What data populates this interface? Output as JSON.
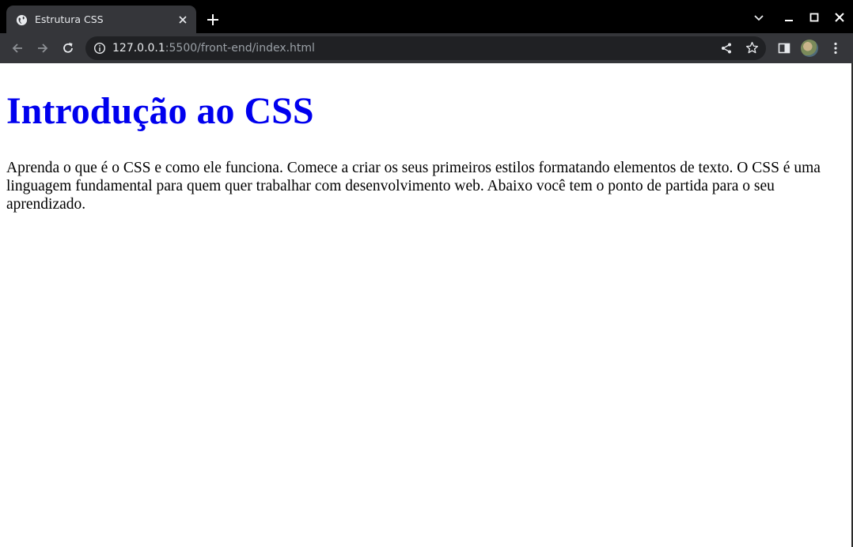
{
  "browser": {
    "tab": {
      "title": "Estrutura CSS",
      "favicon": "globe-icon"
    },
    "window_controls": [
      "chevron-down-icon",
      "minimize-icon",
      "maximize-icon",
      "close-icon"
    ],
    "toolbar": {
      "url_host": "127.0.0.1",
      "url_path": ":5500/front-end/index.html"
    }
  },
  "page": {
    "title": "Introdução ao CSS",
    "paragraph": "Aprenda o que é o CSS e como ele funciona. Comece a criar os seus primeiros estilos formatando elementos de texto. O CSS é uma linguagem fundamental para quem quer trabalhar com desenvolvimento web. Abaixo você tem o ponto de partida para o seu aprendizado."
  },
  "colors": {
    "title": "#0000ee",
    "tab_bg": "#35363a",
    "frame_bg": "#000000",
    "omnibox_bg": "#202124"
  }
}
